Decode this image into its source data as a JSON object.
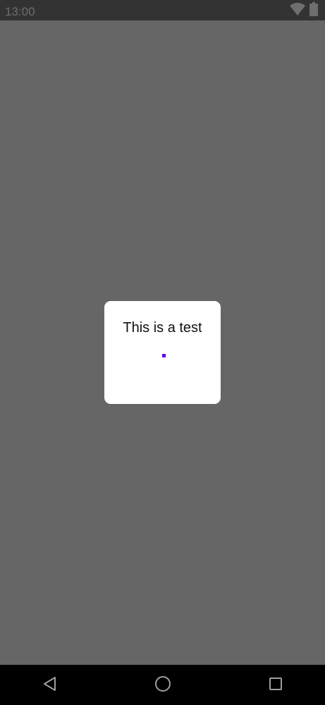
{
  "status_bar": {
    "time": "13:00",
    "icons": [
      "wifi-icon",
      "battery-icon"
    ]
  },
  "dialog": {
    "message": "This is a test",
    "progress_state": "indeterminate"
  },
  "nav_bar": {
    "buttons": [
      "back-icon",
      "home-icon",
      "recents-icon"
    ]
  },
  "colors": {
    "status_bar": "#333333",
    "scrim": "#666666",
    "dialog_background": "#ffffff",
    "accent": "#6200ee",
    "nav_bar": "#000000"
  }
}
